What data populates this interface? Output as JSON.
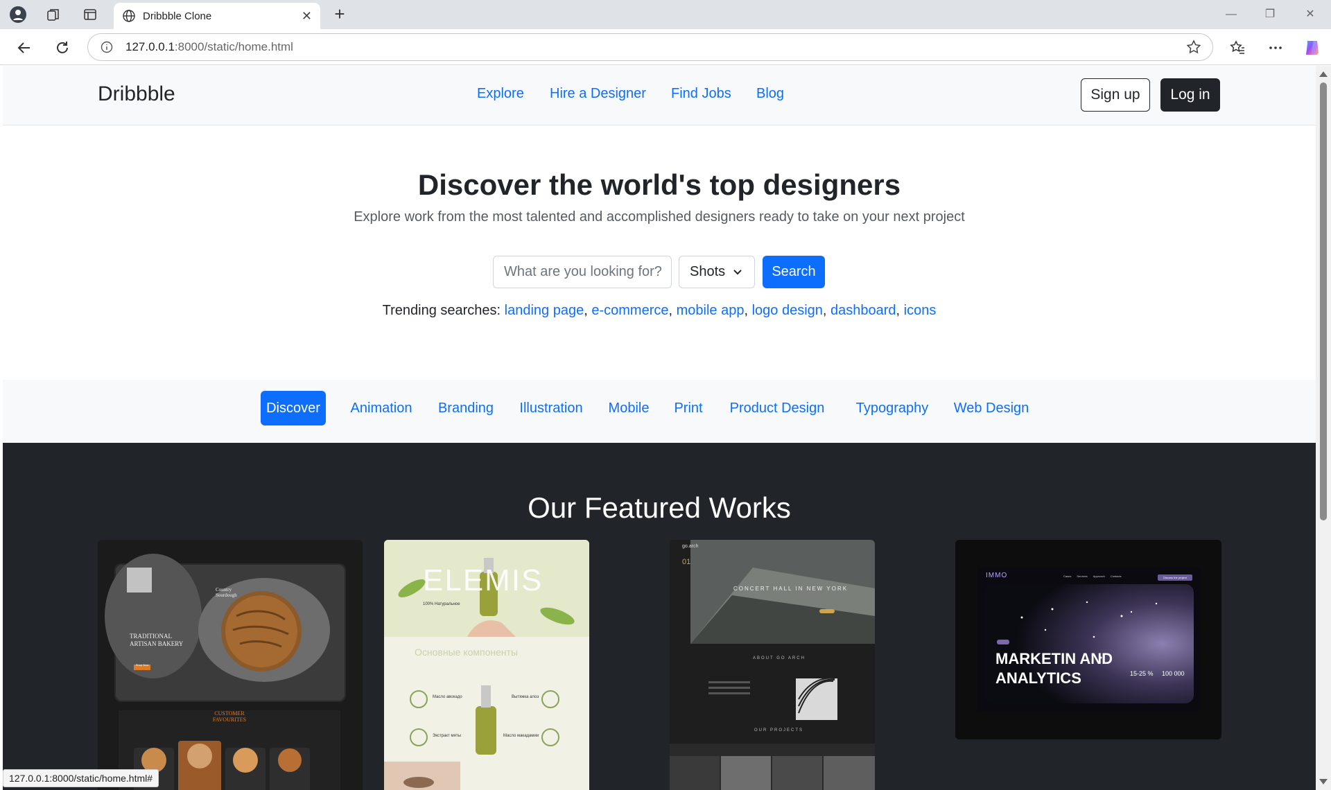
{
  "browser": {
    "tab_title": "Dribbble Clone",
    "url_host": "127.0.0.1",
    "url_rest": ":8000/static/home.html",
    "status_url": "127.0.0.1:8000/static/home.html#"
  },
  "nav": {
    "brand": "Dribbble",
    "links": [
      "Explore",
      "Hire a Designer",
      "Find Jobs",
      "Blog"
    ],
    "signup_label": "Sign up",
    "login_label": "Log in"
  },
  "hero": {
    "title": "Discover the world's top designers",
    "subtitle": "Explore work from the most talented and accomplished designers ready to take on your next project",
    "search_placeholder": "What are you looking for?",
    "search_type": "Shots",
    "search_button": "Search",
    "trending_label": "Trending searches:",
    "trending": [
      "landing page",
      "e-commerce",
      "mobile app",
      "logo design",
      "dashboard",
      "icons"
    ]
  },
  "categories": {
    "items": [
      "Discover",
      "Animation",
      "Branding",
      "Illustration",
      "Mobile",
      "Print",
      "Product Design",
      "Typography",
      "Web Design"
    ],
    "active": "Discover"
  },
  "featured": {
    "title": "Our Featured Works",
    "cards": [
      {
        "heading": "TRADITIONAL ARTISAN BAKERY",
        "side": "Country Sourdough",
        "section": "CUSTOMER FAVOURITES",
        "button": "Shop Now"
      },
      {
        "brand": "ELEMIS",
        "headline": "100% Натуральное",
        "section": "Основные компоненты",
        "items": [
          "Масло авокадо",
          "Вытяжка алоэ",
          "Экстракт мяты",
          "Масло макадамии"
        ]
      },
      {
        "brand": "go.arch",
        "number": "01",
        "headline": "CONCERT HALL IN NEW YORK",
        "about": "ABOUT GO ARCH",
        "projects": "OUR PROJECTS"
      },
      {
        "brand": "IMMO",
        "headline": "MARKETIN AND ANALYTICS",
        "stat1": "15-25 %",
        "stat2": "100 000",
        "menu": [
          "Cases",
          "Services",
          "Approach",
          "Contacts"
        ],
        "cta": "Discuss the project"
      }
    ]
  },
  "colors": {
    "primary": "#0d6efd",
    "dark": "#212529",
    "light": "#f8f9fa"
  }
}
